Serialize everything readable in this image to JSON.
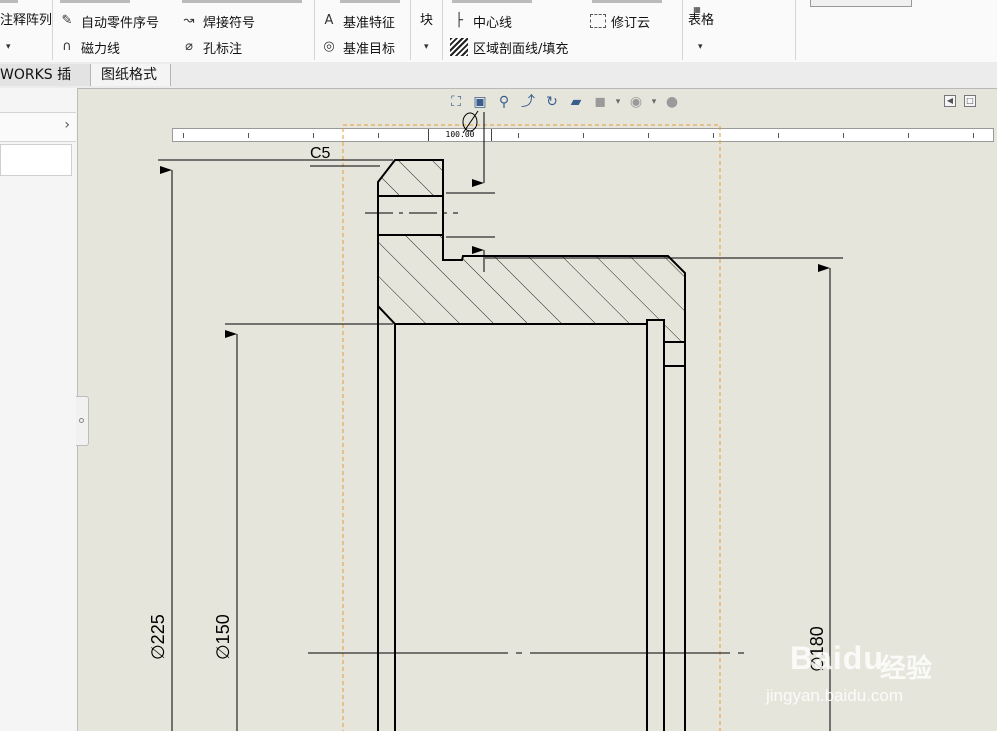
{
  "ribbon": {
    "col1": {
      "array_label": "注释阵列",
      "dropdown": "▾"
    },
    "col2": {
      "auto_balloon": "自动零件序号",
      "magnetic_line": "磁力线"
    },
    "col3": {
      "weld_symbol": "焊接符号",
      "hole_callout": "孔标注"
    },
    "col4": {
      "datum_feature": "基准特征",
      "datum_target": "基准目标"
    },
    "col5": {
      "block_label": "块",
      "dropdown": "▾"
    },
    "col6": {
      "centerline": "中心线",
      "area_hatch": "区域剖面线/填充"
    },
    "col7": {
      "revision_cloud": "修订云"
    },
    "col8": {
      "table_label": "表格",
      "dropdown": "▾"
    }
  },
  "tabs": [
    {
      "label": "WORKS 插件"
    },
    {
      "label": "图纸格式"
    }
  ],
  "ruler": {
    "value": "100.00"
  },
  "drawing": {
    "chamfer_label": "C5",
    "dim_225": "∅225",
    "dim_150": "∅150",
    "dim_180": "∅180"
  },
  "watermark": {
    "brand": "Baidu",
    "suffix": "经验",
    "url": "jingyan.baidu.com"
  }
}
